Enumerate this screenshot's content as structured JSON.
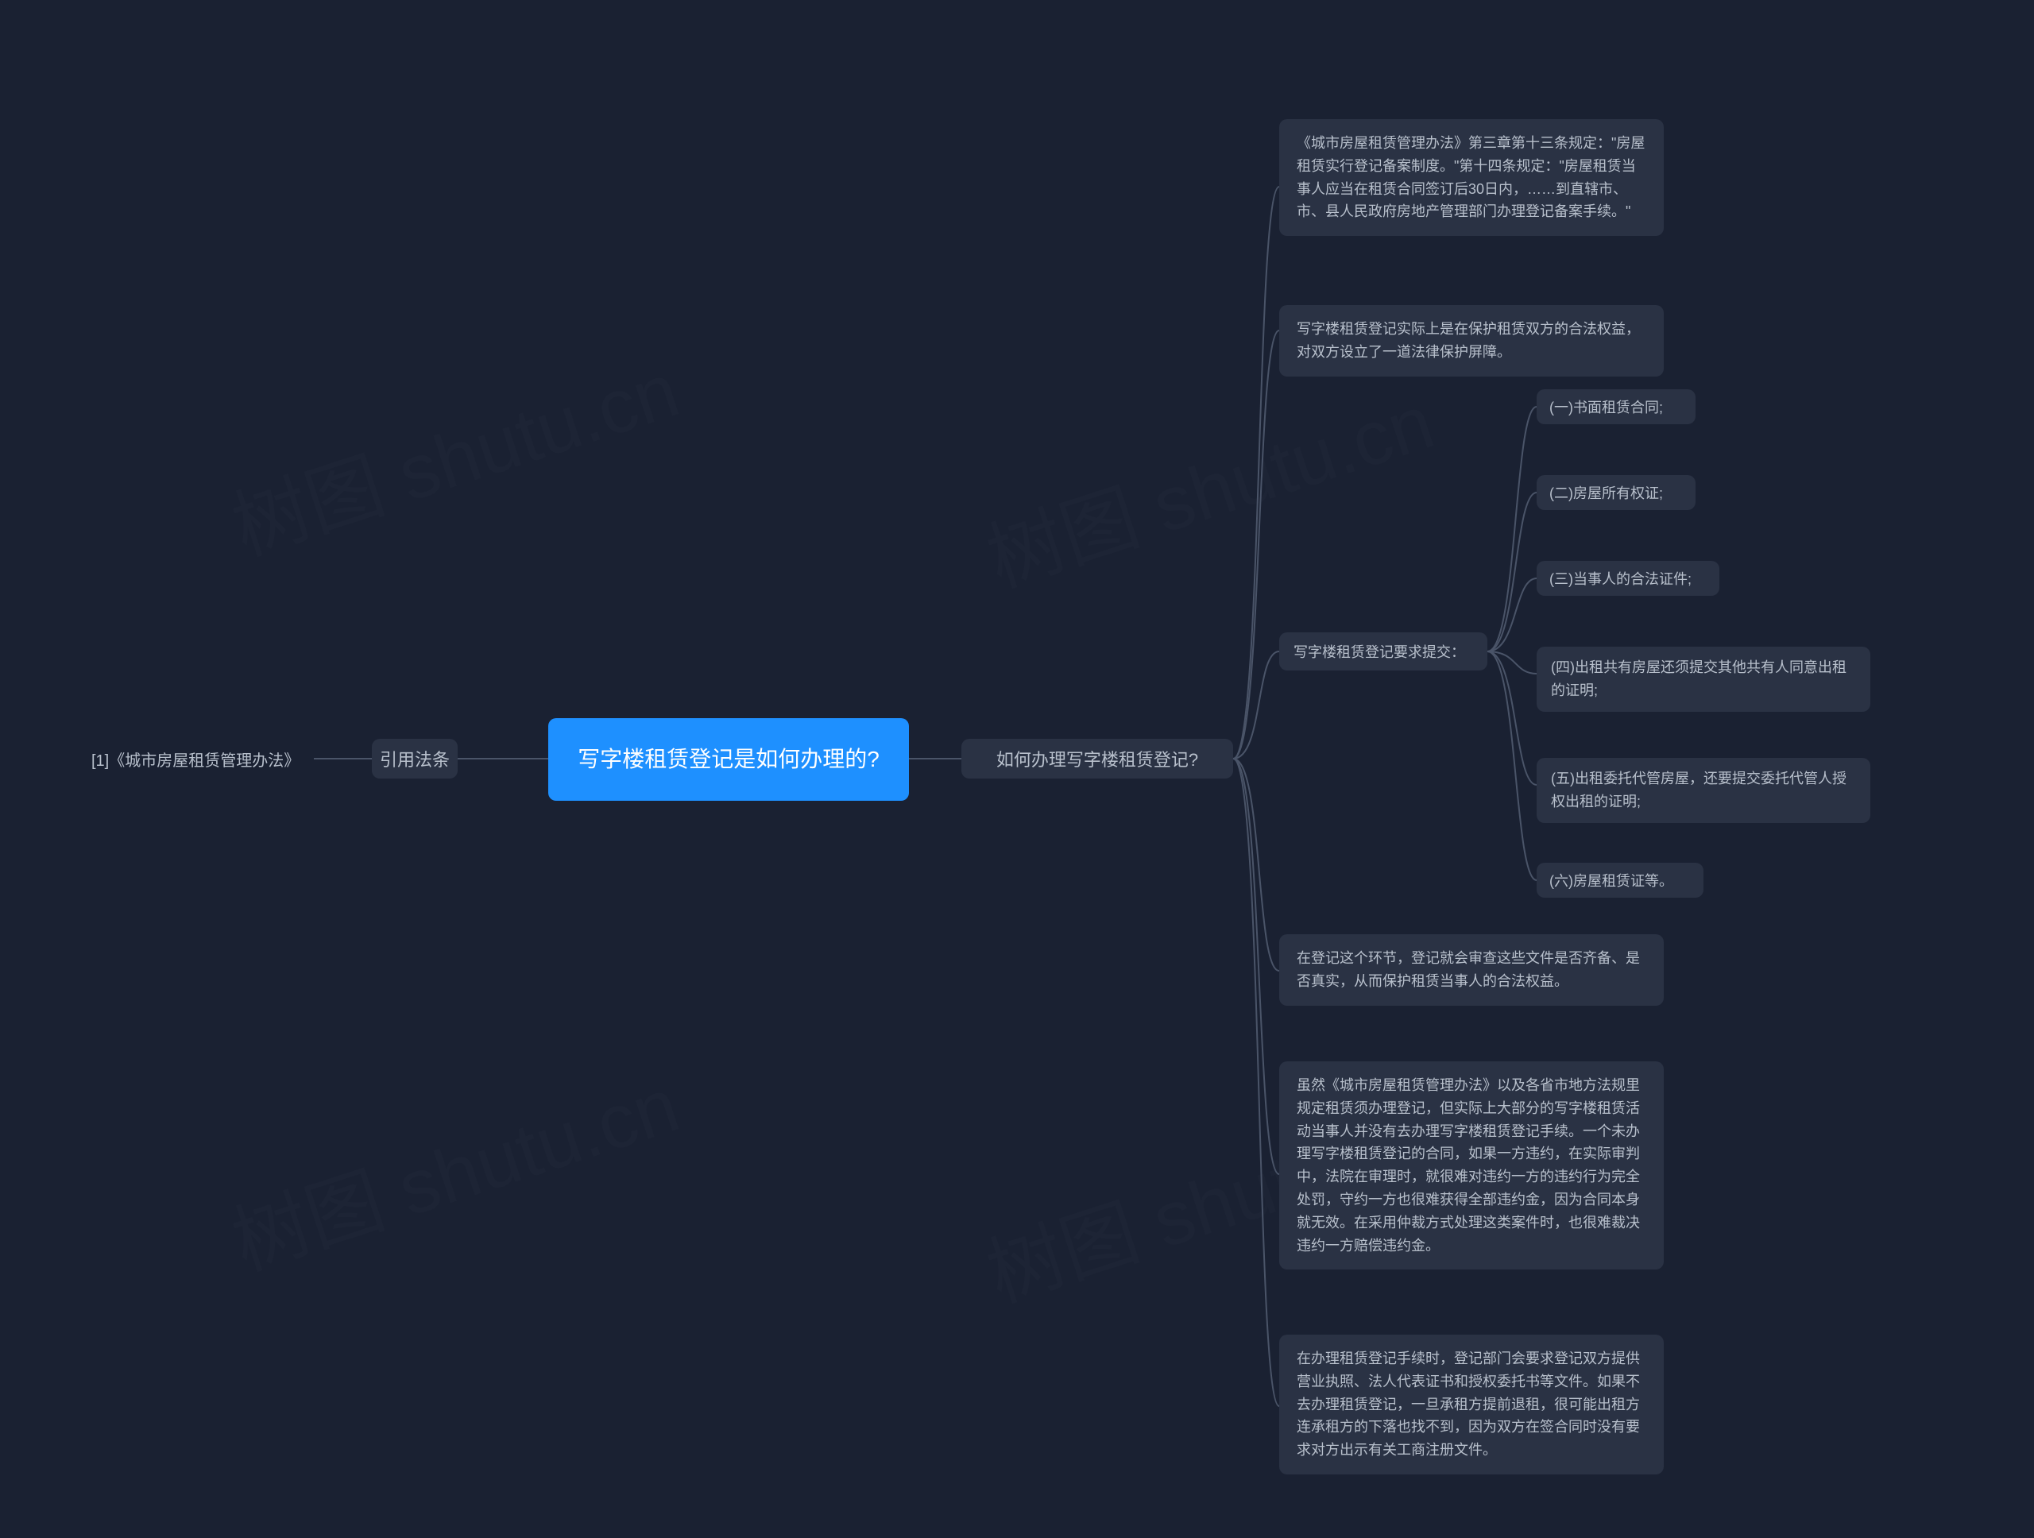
{
  "watermark": "树图 shutu.cn",
  "root": {
    "title": "写字楼租赁登记是如何办理的?"
  },
  "left": {
    "branch_label": "引用法条",
    "ref_label": "[1]《城市房屋租赁管理办法》"
  },
  "right": {
    "branch_label": "如何办理写字楼租赁登记?",
    "children": {
      "c1": "《城市房屋租赁管理办法》第三章第十三条规定：\"房屋租赁实行登记备案制度。\"第十四条规定：\"房屋租赁当事人应当在租赁合同签订后30日内，……到直辖市、市、县人民政府房地产管理部门办理登记备案手续。\"",
      "c2": "写字楼租赁登记实际上是在保护租赁双方的合法权益，对双方设立了一道法律保护屏障。",
      "c3": {
        "label": "写字楼租赁登记要求提交：",
        "items": {
          "i1": "(一)书面租赁合同;",
          "i2": "(二)房屋所有权证;",
          "i3": "(三)当事人的合法证件;",
          "i4": "(四)出租共有房屋还须提交其他共有人同意出租的证明;",
          "i5": "(五)出租委托代管房屋，还要提交委托代管人授权出租的证明;",
          "i6": "(六)房屋租赁证等。"
        }
      },
      "c4": "在登记这个环节，登记就会审查这些文件是否齐备、是否真实，从而保护租赁当事人的合法权益。",
      "c5": "虽然《城市房屋租赁管理办法》以及各省市地方法规里规定租赁须办理登记，但实际上大部分的写字楼租赁活动当事人并没有去办理写字楼租赁登记手续。一个未办理写字楼租赁登记的合同，如果一方违约，在实际审判中，法院在审理时，就很难对违约一方的违约行为完全处罚，守约一方也很难获得全部违约金，因为合同本身就无效。在采用仲裁方式处理这类案件时，也很难裁决违约一方赔偿违约金。",
      "c6": "在办理租赁登记手续时，登记部门会要求登记双方提供营业执照、法人代表证书和授权委托书等文件。如果不去办理租赁登记，一旦承租方提前退租，很可能出租方连承租方的下落也找不到，因为双方在签合同时没有要求对方出示有关工商注册文件。"
    }
  }
}
